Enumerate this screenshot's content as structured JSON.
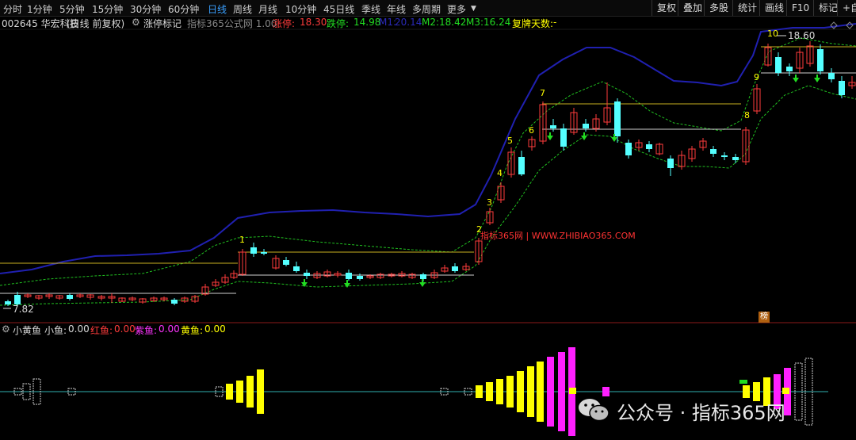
{
  "period_tabs": [
    {
      "label": "分时"
    },
    {
      "label": "1分钟"
    },
    {
      "label": "5分钟"
    },
    {
      "label": "15分钟"
    },
    {
      "label": "30分钟"
    },
    {
      "label": "60分钟"
    },
    {
      "label": "日线",
      "active": true
    },
    {
      "label": "周线"
    },
    {
      "label": "月线"
    },
    {
      "label": "10分钟"
    },
    {
      "label": "45日线"
    },
    {
      "label": "季线"
    },
    {
      "label": "年线"
    },
    {
      "label": "多周期"
    },
    {
      "label": "更多"
    }
  ],
  "toolbar": {
    "fuquan": "复权",
    "diejia": "叠加",
    "duogu": "多股",
    "tongji": "统计",
    "huaxian": "画线",
    "f10": "F10",
    "biaoji": "标记",
    "plus": "+自"
  },
  "info": {
    "code_name": "002645 华宏科技",
    "period_desc": "(日线 前复权)",
    "indicator": "涨停标记",
    "formula": "指标365公式网 1.00",
    "zhangting_label": "涨停:",
    "zhangting_value": "18.30",
    "dieting_label": "跌停:",
    "dieting_value": "14.98",
    "m1_label": "M1:",
    "m1_value": "20.14",
    "m2_label": "M2:",
    "m2_value": "18.42",
    "m3_label": "M3:",
    "m3_value": "16.24",
    "fupai_label": "复牌天数:",
    "fupai_value": "-"
  },
  "sub": {
    "name": "小黄鱼",
    "xiaoyu_label": "小鱼:",
    "xiaoyu_value": "0.00",
    "hongyu_label": "红鱼:",
    "hongyu_value": "0.00",
    "ziyu_label": "紫鱼:",
    "ziyu_value": "0.00",
    "huangyu_label": "黄鱼:",
    "huangyu_value": "0.00"
  },
  "price_labels": {
    "high": "18.60",
    "low": "7.82"
  },
  "watermark": "指标365网 | WWW.ZHIBIAO365.COM",
  "wechat": "公众号 · 指标365网",
  "badge": "榜",
  "wave_labels": [
    "1",
    "2",
    "3",
    "4",
    "5",
    "6",
    "7",
    "8",
    "9",
    "10"
  ],
  "colors": {
    "up": "#ff3c3c",
    "down": "#54ffff",
    "ma_blue": "#2020b0",
    "band": "#20c020",
    "yellow": "#ffff00",
    "magenta": "#ff20ff"
  }
}
